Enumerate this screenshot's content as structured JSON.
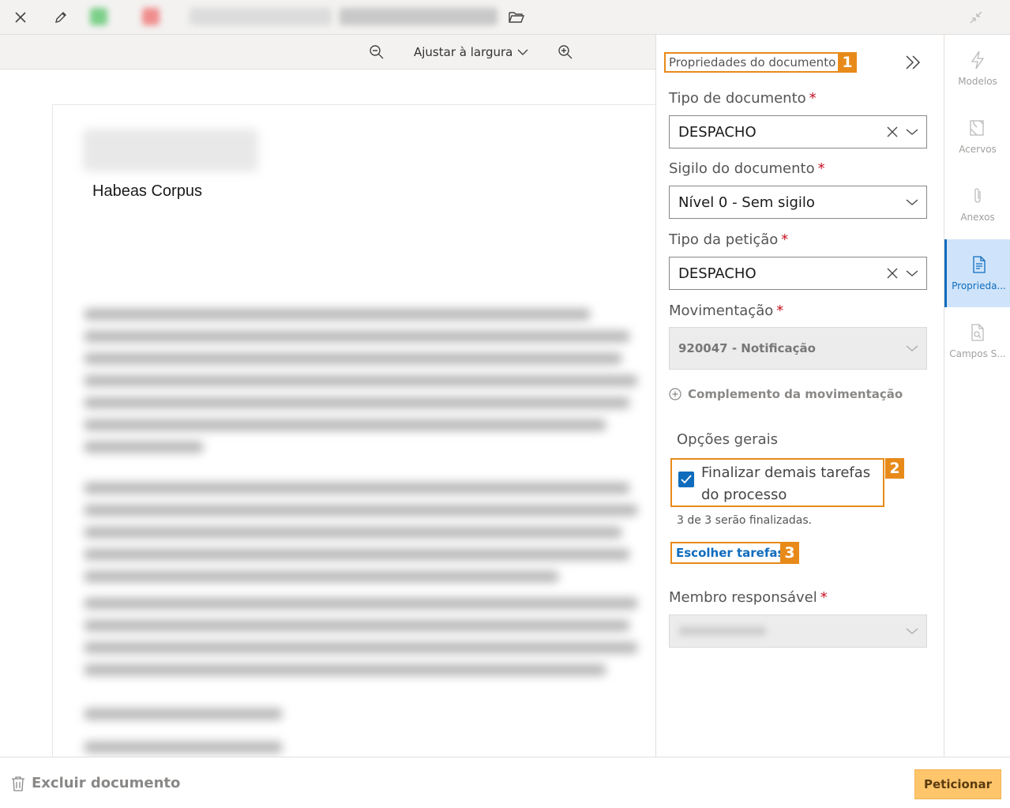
{
  "toolbar": {
    "close_icon": "close-icon",
    "edit_icon": "pencil-icon",
    "folder_icon": "folder-open-icon",
    "minimize_icon": "collapse-arrows-icon"
  },
  "zoom": {
    "zoom_out_icon": "zoom-out-icon",
    "mode_label": "Ajustar à largura",
    "zoom_in_icon": "zoom-in-icon"
  },
  "document": {
    "heading": "Habeas Corpus"
  },
  "panel": {
    "title": "Propriedades do documento",
    "badge1": "1",
    "badge2": "2",
    "badge3": "3",
    "fields": {
      "tipo_documento": {
        "label": "Tipo de documento",
        "required": "*",
        "value": "DESPACHO"
      },
      "sigilo": {
        "label": "Sigilo do documento",
        "required": "*",
        "value": "Nível 0 - Sem sigilo"
      },
      "tipo_peticao": {
        "label": "Tipo da petição",
        "required": "*",
        "value": "DESPACHO"
      },
      "movimentacao": {
        "label": "Movimentação",
        "required": "*",
        "value": "920047 - Notificação"
      },
      "membro": {
        "label": "Membro responsável",
        "required": "*",
        "value": ""
      }
    },
    "complemento_label": "Complemento da movimentação",
    "opcoes_title": "Opções gerais",
    "finalizar_label": "Finalizar demais tarefas do processo",
    "finalizar_checked": true,
    "count_text": "3 de 3 serão finalizadas.",
    "escolher_label": "Escolher tarefas"
  },
  "rail": {
    "items": [
      {
        "label": "Modelos",
        "icon": "lightning-icon"
      },
      {
        "label": "Acervos",
        "icon": "archive-icon"
      },
      {
        "label": "Anexos",
        "icon": "paperclip-icon"
      },
      {
        "label": "Proprieda...",
        "icon": "properties-icon"
      },
      {
        "label": "Campos S...",
        "icon": "search-document-icon"
      }
    ]
  },
  "footer": {
    "delete_label": "Excluir documento",
    "submit_label": "Peticionar"
  },
  "colors": {
    "accent": "#0f6cbd",
    "highlight": "#e88a1a",
    "submit": "#ffc56b"
  }
}
